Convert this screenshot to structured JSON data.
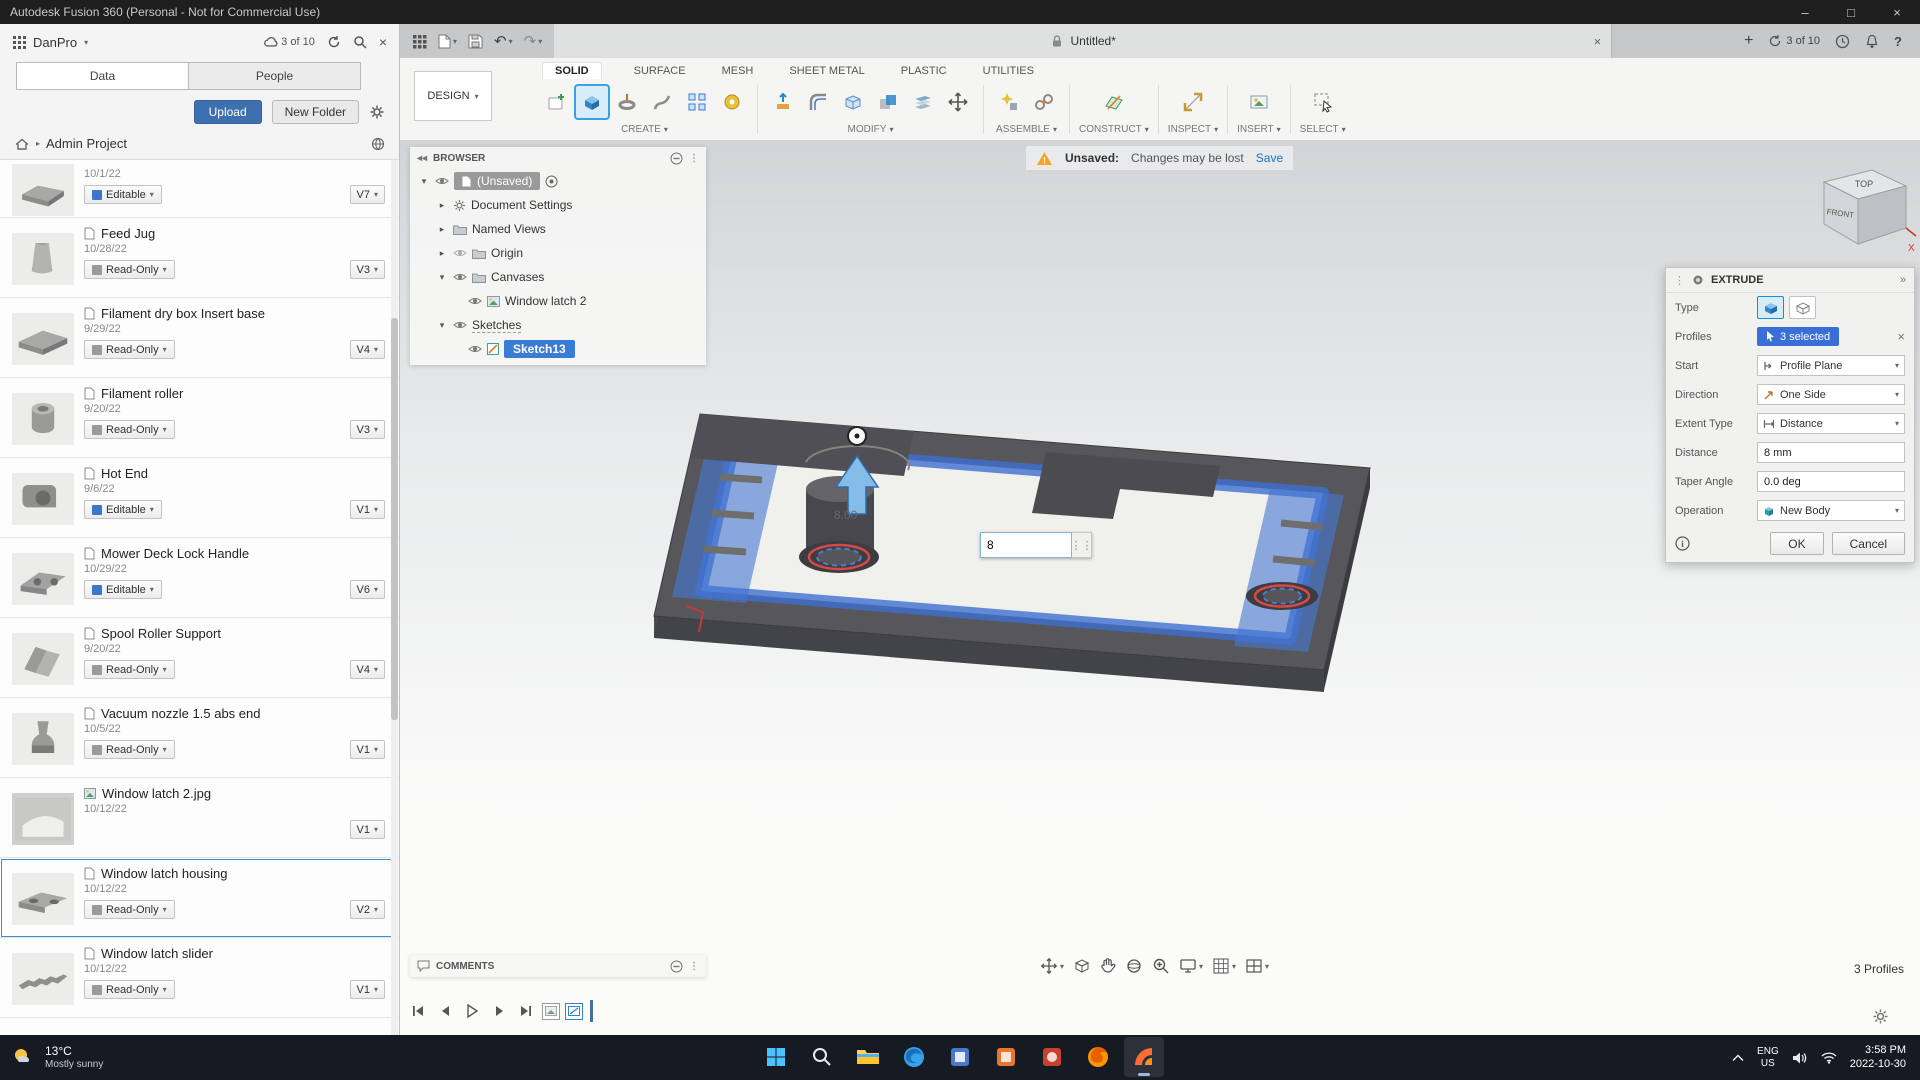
{
  "accents": {
    "fusion_blue": "#0696d7",
    "selection_blue": "#3a6fd8",
    "warning_orange": "#f0a818",
    "link_blue": "#1a73c7",
    "upload_blue": "#3e6fae",
    "taskbar_bg": "#151a23"
  },
  "titlebar": {
    "title": "Autodesk Fusion 360 (Personal - Not for Commercial Use)"
  },
  "left_panel": {
    "team": "DanPro",
    "sync_count": "3 of 10",
    "tab_data": "Data",
    "tab_people": "People",
    "upload": "Upload",
    "new_folder": "New Folder",
    "breadcrumb": "Admin Project",
    "items": [
      {
        "name": "",
        "date": "10/1/22",
        "access": "Editable",
        "version": "V7"
      },
      {
        "name": "Feed Jug",
        "date": "10/28/22",
        "access": "Read-Only",
        "version": "V3"
      },
      {
        "name": "Filament dry box Insert base",
        "date": "9/29/22",
        "access": "Read-Only",
        "version": "V4"
      },
      {
        "name": "Filament roller",
        "date": "9/20/22",
        "access": "Read-Only",
        "version": "V3"
      },
      {
        "name": "Hot End",
        "date": "9/6/22",
        "access": "Editable",
        "version": "V1"
      },
      {
        "name": "Mower Deck Lock Handle",
        "date": "10/29/22",
        "access": "Editable",
        "version": "V6"
      },
      {
        "name": "Spool Roller Support",
        "date": "9/20/22",
        "access": "Read-Only",
        "version": "V4"
      },
      {
        "name": "Vacuum nozzle 1.5 abs end",
        "date": "10/5/22",
        "access": "Read-Only",
        "version": "V1"
      },
      {
        "name": "Window latch 2.jpg",
        "date": "10/12/22",
        "access": "",
        "version": "V1"
      },
      {
        "name": "Window latch housing",
        "date": "10/12/22",
        "access": "Read-Only",
        "version": "V2"
      },
      {
        "name": "Window latch slider",
        "date": "10/12/22",
        "access": "Read-Only",
        "version": "V1"
      }
    ]
  },
  "tabbar": {
    "document_title": "Untitled*",
    "sync_count": "3 of 10"
  },
  "ribbon": {
    "design": "DESIGN",
    "tabs": [
      "SOLID",
      "SURFACE",
      "MESH",
      "SHEET METAL",
      "PLASTIC",
      "UTILITIES"
    ],
    "groups": [
      "CREATE",
      "MODIFY",
      "ASSEMBLE",
      "CONSTRUCT",
      "INSPECT",
      "INSERT",
      "SELECT"
    ]
  },
  "browser": {
    "title": "BROWSER",
    "nodes": [
      "(Unsaved)",
      "Document Settings",
      "Named Views",
      "Origin",
      "Canvases",
      "Window latch 2",
      "Sketches",
      "Sketch13"
    ]
  },
  "warning": {
    "label": "Unsaved:",
    "message": "Changes may be lost",
    "action": "Save"
  },
  "dialog": {
    "title": "EXTRUDE",
    "type_label": "Type",
    "profiles_label": "Profiles",
    "profiles_value": "3 selected",
    "start_label": "Start",
    "start_value": "Profile Plane",
    "direction_label": "Direction",
    "direction_value": "One Side",
    "extent_label": "Extent Type",
    "extent_value": "Distance",
    "distance_label": "Distance",
    "distance_value": "8 mm",
    "taper_label": "Taper Angle",
    "taper_value": "0.0 deg",
    "operation_label": "Operation",
    "operation_value": "New Body",
    "ok": "OK",
    "cancel": "Cancel"
  },
  "viewport": {
    "comments": "COMMENTS",
    "profiles": "3 Profiles",
    "dim_input": "8",
    "dim_ghost": "8.00"
  },
  "viewcube": {
    "top": "TOP",
    "front": "FRONT",
    "axis_x": "X"
  },
  "taskbar": {
    "temp": "13°C",
    "weather": "Mostly sunny",
    "lang": "ENG",
    "region": "US",
    "time": "3:58 PM",
    "date": "2022-10-30"
  }
}
